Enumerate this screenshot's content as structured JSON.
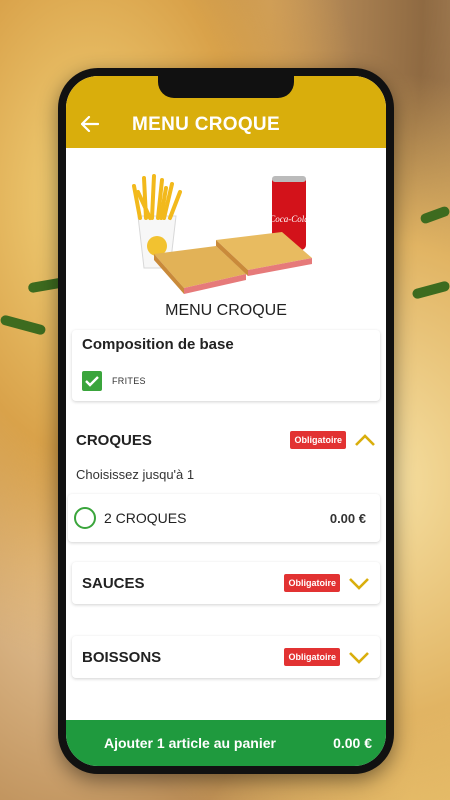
{
  "header": {
    "title": "MENU CROQUE"
  },
  "product": {
    "name": "MENU CROQUE",
    "image_alt": "fries-drink-croque-icon",
    "can_text": "Coca-Cola"
  },
  "base_composition": {
    "title": "Composition de base",
    "items": [
      {
        "label": "FRITES",
        "checked": true
      }
    ]
  },
  "groups": [
    {
      "title": "CROQUES",
      "badge": "Obligatoire",
      "expanded": true,
      "hint": "Choisissez jusqu'à 1",
      "options": [
        {
          "label": "2 CROQUES",
          "price": "0.00 €"
        }
      ]
    },
    {
      "title": "SAUCES",
      "badge": "Obligatoire",
      "expanded": false
    },
    {
      "title": "BOISSONS",
      "badge": "Obligatoire",
      "expanded": false
    }
  ],
  "cart": {
    "label": "Ajouter 1 article au panier",
    "price": "0.00 €"
  },
  "colors": {
    "appbar": "#d9ae0c",
    "cart": "#1f9a3e",
    "badge": "#e23232",
    "check": "#3aa53c"
  }
}
